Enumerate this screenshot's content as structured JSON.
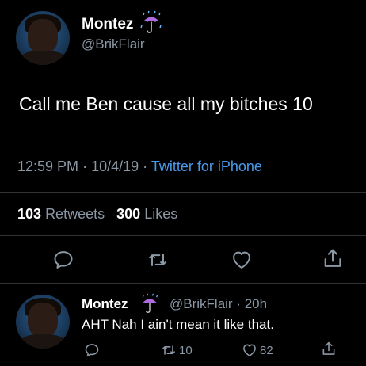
{
  "tweet": {
    "author_name": "Montez",
    "author_handle": "@BrikFlair",
    "emoji": "umbrella-with-rain-icon",
    "text": "Call me Ben cause all my bitches 10",
    "time": "12:59 PM",
    "date": "10/4/19",
    "separator": "·",
    "source": "Twitter for iPhone",
    "retweets_count": "103",
    "retweets_label": "Retweets",
    "likes_count": "300",
    "likes_label": "Likes"
  },
  "reply": {
    "author_name": "Montez",
    "author_handle": "@BrikFlair",
    "separator": "·",
    "age": "20h",
    "text": "AHT Nah I ain't mean it like that.",
    "retweets_count": "10",
    "likes_count": "82"
  },
  "colors": {
    "background": "#000000",
    "text_primary": "#ffffff",
    "text_secondary": "#8b98a5",
    "link": "#4a99e9",
    "divider": "#2f3336"
  }
}
